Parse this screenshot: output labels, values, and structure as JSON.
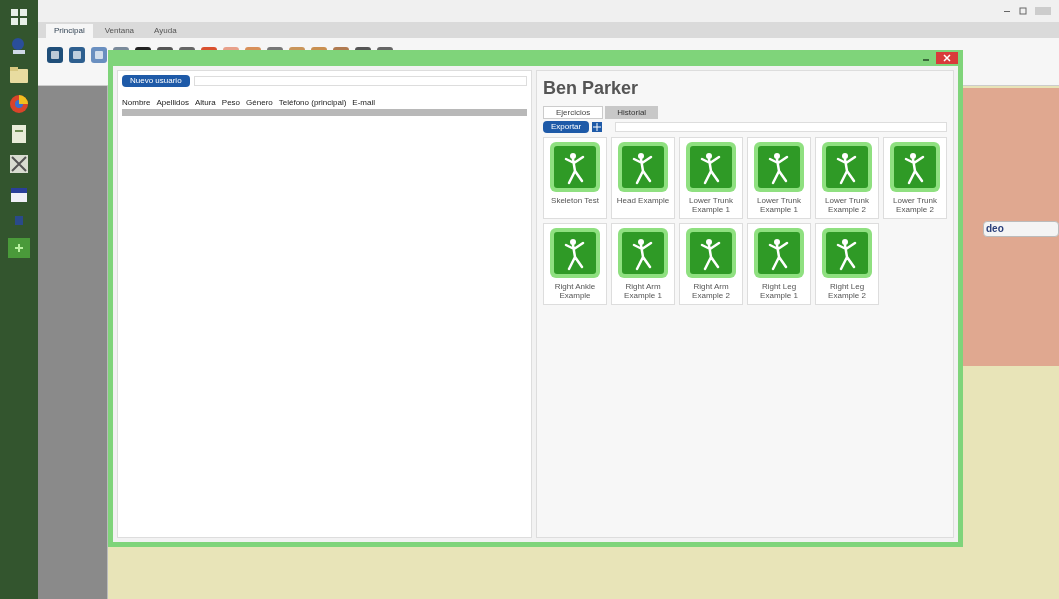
{
  "app": {
    "tabs": [
      {
        "label": "Principal",
        "selected": true
      },
      {
        "label": "Ventana",
        "selected": false
      },
      {
        "label": "Ayuda",
        "selected": false
      }
    ],
    "side_panel": {
      "text": "deo"
    }
  },
  "dialog": {
    "new_button": "Nuevo usuario",
    "columns": [
      "Nombre",
      "Apellidos",
      "Altura",
      "Peso",
      "Género",
      "Teléfono (principal)",
      "E-mail"
    ],
    "rows": [
      {
        "selected": true
      }
    ],
    "name": "Ben Parker",
    "tabs": [
      {
        "label": "Ejercicios",
        "selected": true
      },
      {
        "label": "Historial",
        "selected": false
      }
    ],
    "export_button": "Exportar",
    "items": [
      {
        "label": "Skeleton Test"
      },
      {
        "label": "Head Example"
      },
      {
        "label": "Lower Trunk Example 1"
      },
      {
        "label": "Lower Trunk Example 1"
      },
      {
        "label": "Lower Trunk Example 2"
      },
      {
        "label": "Lower Trunk Example 2"
      },
      {
        "label": "Right Ankle Example"
      },
      {
        "label": "Right Arm Example 1"
      },
      {
        "label": "Right Arm Example 2"
      },
      {
        "label": "Right Leg Example 1"
      },
      {
        "label": "Right Leg Example 2"
      }
    ]
  }
}
